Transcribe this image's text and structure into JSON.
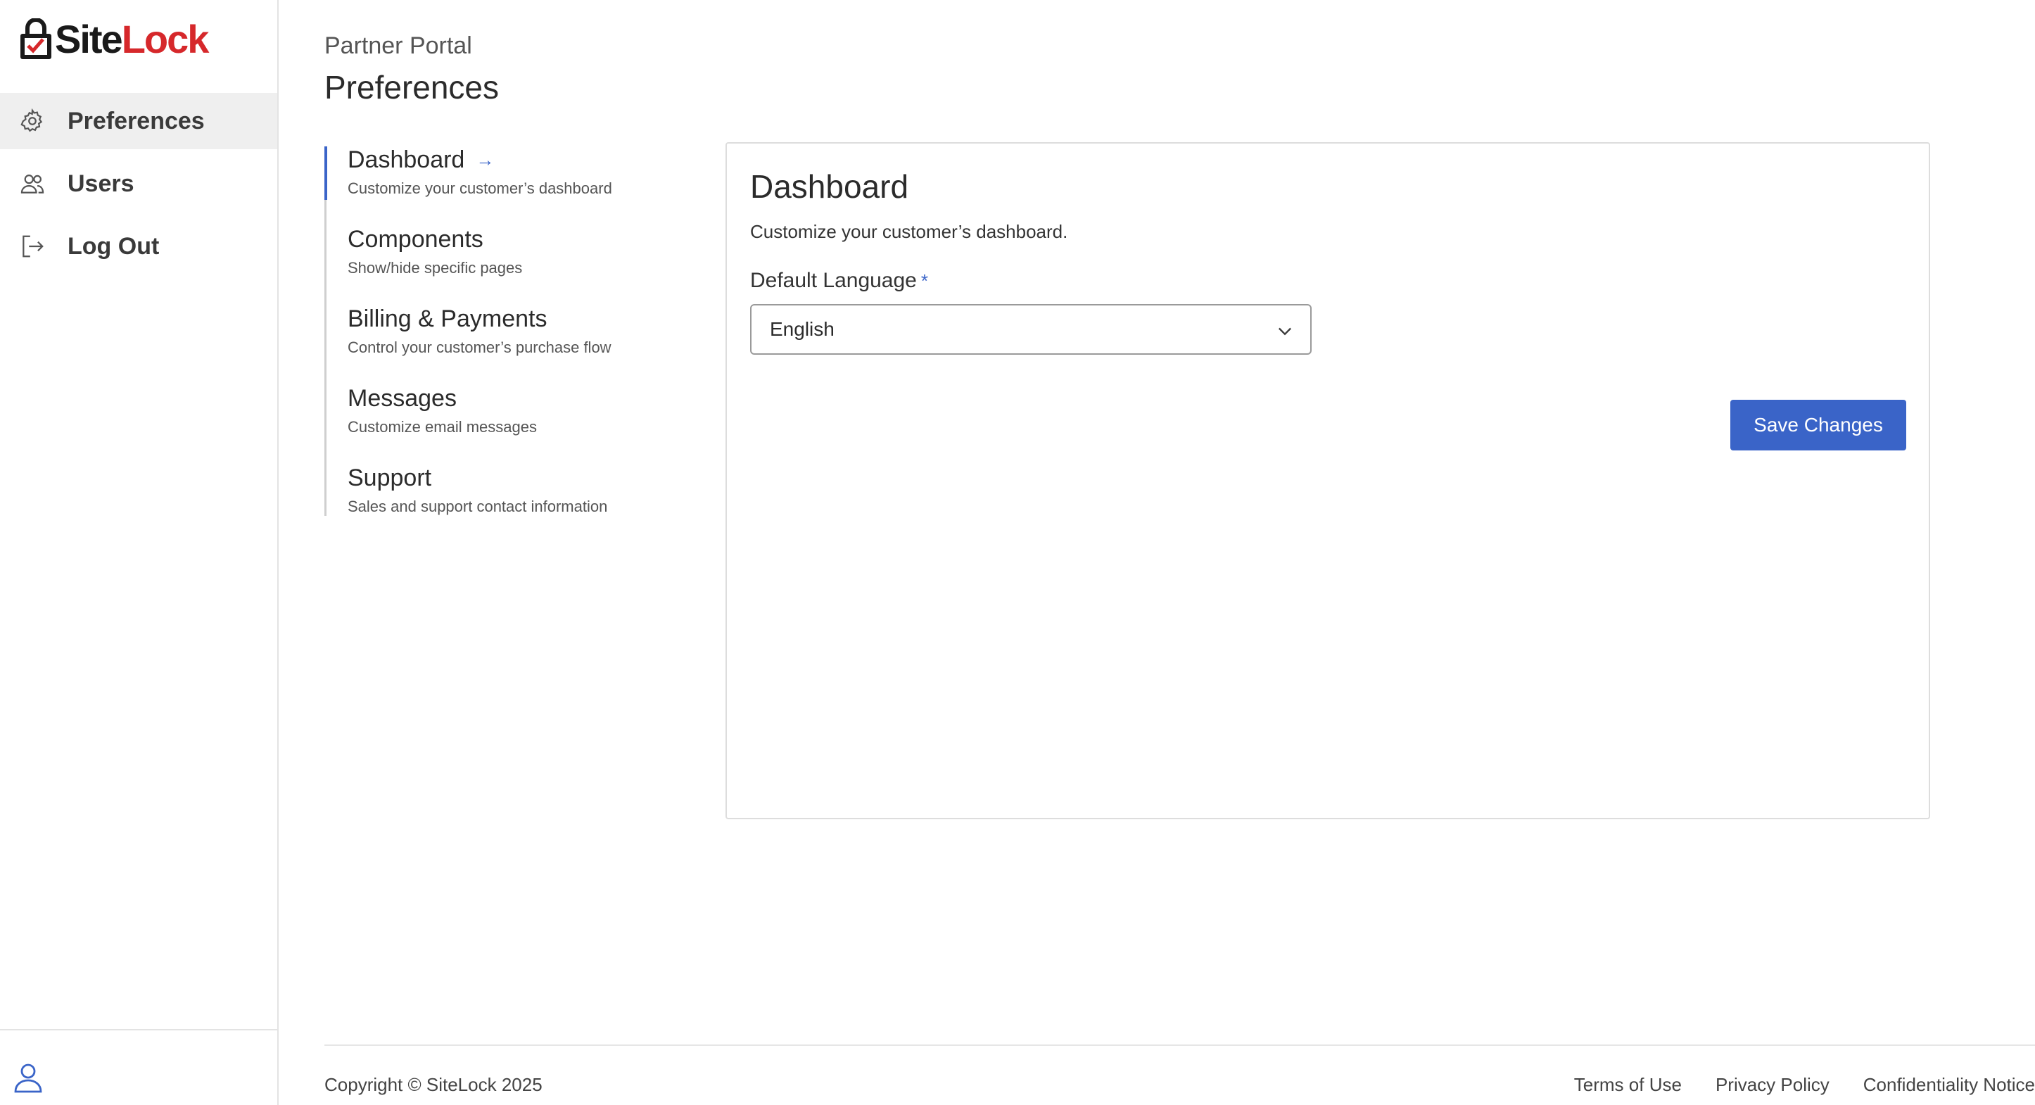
{
  "brand": {
    "logo_part1": "Site",
    "logo_part2": "Lock",
    "logo_accent": "#d6282b"
  },
  "sidebar": {
    "items": [
      {
        "label": "Preferences",
        "icon": "gear-icon",
        "active": true
      },
      {
        "label": "Users",
        "icon": "users-icon",
        "active": false
      },
      {
        "label": "Log Out",
        "icon": "logout-icon",
        "active": false
      }
    ],
    "bottom_icon": "user-icon"
  },
  "header": {
    "portal_label": "Partner Portal",
    "title": "Preferences"
  },
  "subnav": {
    "items": [
      {
        "title": "Dashboard",
        "desc": "Customize your customer’s dashboard",
        "active": true
      },
      {
        "title": "Components",
        "desc": "Show/hide specific pages"
      },
      {
        "title": "Billing & Payments",
        "desc": "Control your customer’s purchase flow"
      },
      {
        "title": "Messages",
        "desc": "Customize email messages"
      },
      {
        "title": "Support",
        "desc": "Sales and support contact information"
      }
    ]
  },
  "panel": {
    "title": "Dashboard",
    "description": "Customize your customer’s dashboard.",
    "field_label": "Default Language",
    "required_mark": "*",
    "select_value": "English",
    "save_label": "Save Changes"
  },
  "footer": {
    "copyright": "Copyright © SiteLock 2025",
    "links": [
      "Terms of Use",
      "Privacy Policy",
      "Confidentiality Notice"
    ]
  },
  "colors": {
    "primary": "#3a64c8",
    "active_bg": "#efefef"
  }
}
